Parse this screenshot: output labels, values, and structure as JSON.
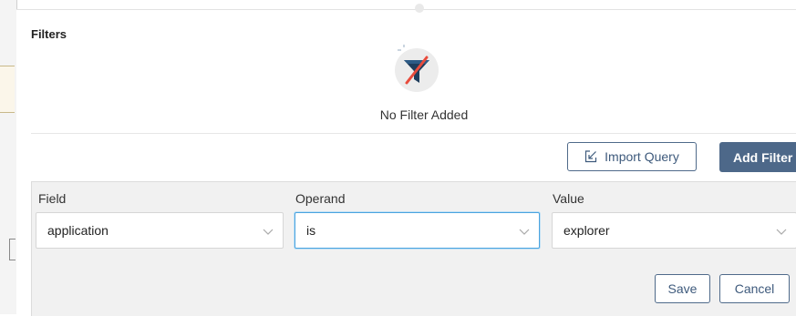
{
  "dialog": {
    "title": "Filters",
    "empty_state": {
      "icon": "no-filter-icon",
      "text": "No Filter Added"
    }
  },
  "actions": {
    "import_label": "Import Query",
    "import_icon": "import-icon",
    "add_label": "Add Filter"
  },
  "filter_row": {
    "field": {
      "label": "Field",
      "value": "application"
    },
    "operand": {
      "label": "Operand",
      "value": "is"
    },
    "value": {
      "label": "Value",
      "value": "explorer"
    }
  },
  "form_buttons": {
    "save_label": "Save",
    "cancel_label": "Cancel"
  },
  "colors": {
    "primary": "#4d6889",
    "focus": "#4aa3df",
    "panel_bg": "#f1f1f1"
  }
}
